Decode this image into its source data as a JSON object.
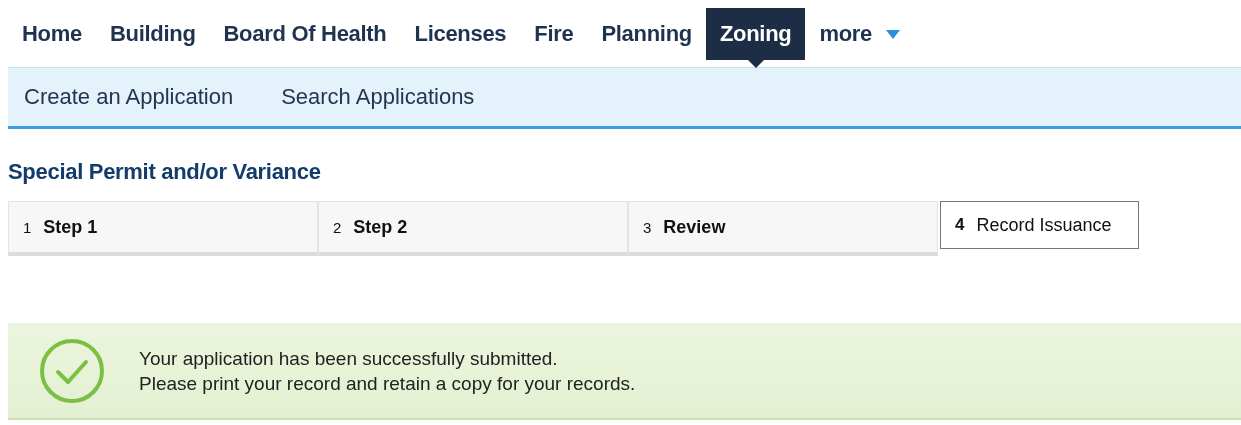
{
  "nav": {
    "items": [
      {
        "label": "Home",
        "selected": false
      },
      {
        "label": "Building",
        "selected": false
      },
      {
        "label": "Board Of Health",
        "selected": false
      },
      {
        "label": "Licenses",
        "selected": false
      },
      {
        "label": "Fire",
        "selected": false
      },
      {
        "label": "Planning",
        "selected": false
      },
      {
        "label": "Zoning",
        "selected": true
      },
      {
        "label": "more",
        "selected": false,
        "kind": "dropdown"
      }
    ]
  },
  "subnav": {
    "links": [
      "Create an Application",
      "Search Applications"
    ]
  },
  "page_title": "Special Permit and/or Variance",
  "steps": [
    {
      "number": "1",
      "label": "Step 1",
      "selected": false
    },
    {
      "number": "2",
      "label": "Step 2",
      "selected": false
    },
    {
      "number": "3",
      "label": "Review",
      "selected": false
    },
    {
      "number": "4",
      "label": "Record Issuance",
      "selected": true
    }
  ],
  "message": {
    "lines": [
      "Your application has been successfully submitted.",
      "Please print your record and retain a copy for your records."
    ]
  }
}
